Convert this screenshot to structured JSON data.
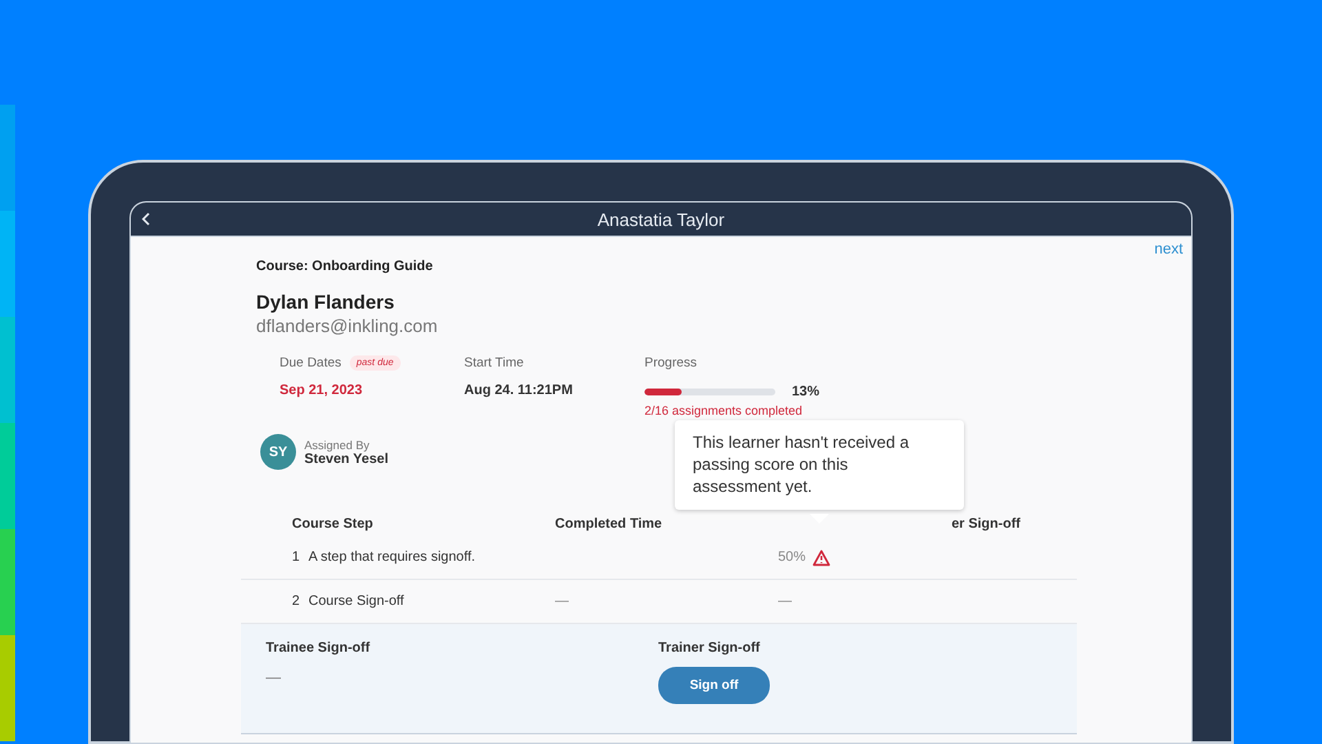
{
  "header": {
    "title": "Anastatia Taylor",
    "next_link": "next"
  },
  "course": "Course: Onboarding Guide",
  "learner": {
    "name": "Dylan Flanders",
    "email": "dflanders@inkling.com"
  },
  "due": {
    "label": "Due Dates",
    "badge": "past due",
    "value": "Sep 21, 2023"
  },
  "start": {
    "label": "Start Time",
    "value": "Aug 24. 11:21PM"
  },
  "progress": {
    "label": "Progress",
    "level": 0.28,
    "reading": "13%",
    "summary": "2/16 assignments completed"
  },
  "assigned": {
    "initials": "SY",
    "label": "Assigned By",
    "name": "Steven Yesel"
  },
  "table": {
    "columns": {
      "column_1": "Course Step",
      "column_2": "Completed Time",
      "column_4": "er Sign-off"
    },
    "rows": [
      {
        "number": "1",
        "step": "A step that requires signoff.",
        "column_3": "50%",
        "warning": true
      },
      {
        "number": "2",
        "step": "Course Sign-off",
        "completed_time": "—",
        "column_3": "—",
        "warning": false
      }
    ]
  },
  "tooltip": {
    "text": "This learner hasn't received a passing score on this assessment yet."
  },
  "signoff": {
    "trainee_label": "Trainee Sign-off",
    "trainee_value": "—",
    "trainer_label": "Trainer Sign-off",
    "button": "Sign off"
  }
}
